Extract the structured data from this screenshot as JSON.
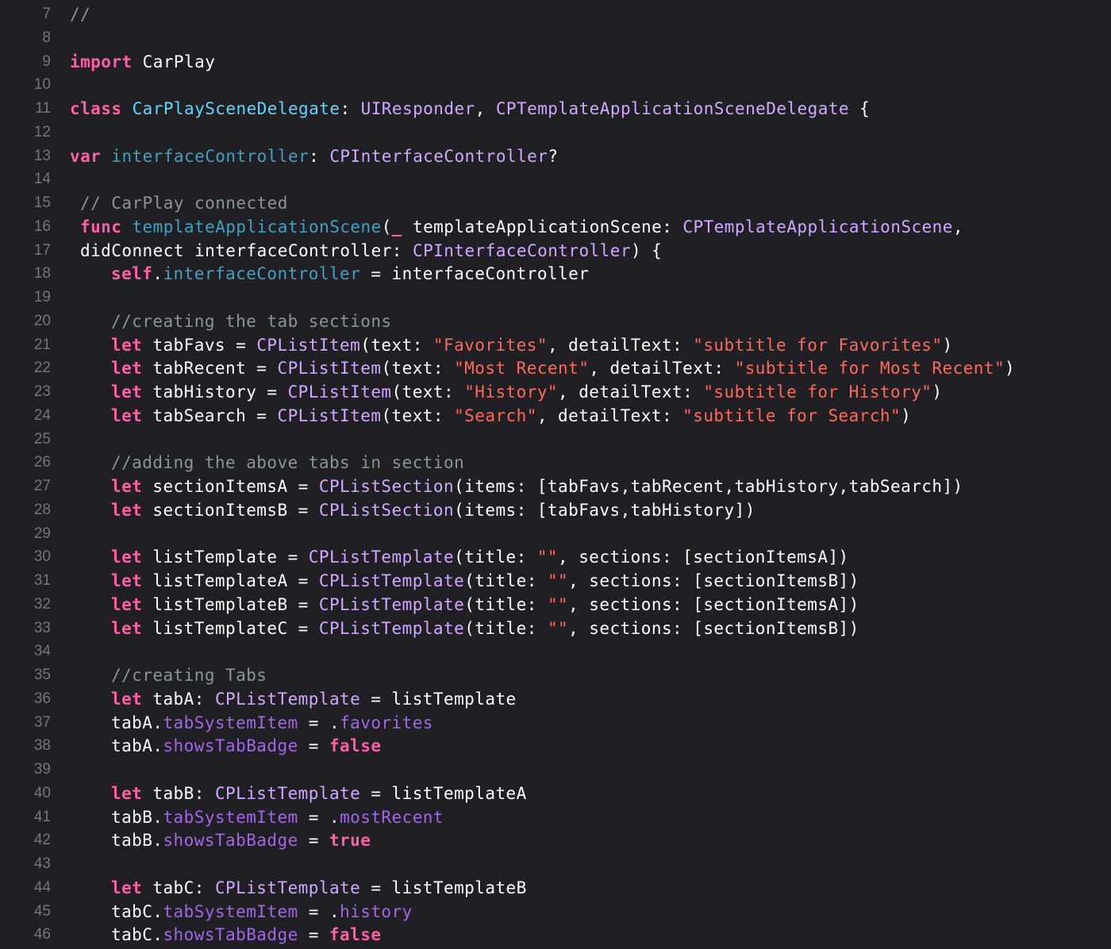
{
  "editor": {
    "colors": {
      "background": "#1f1f24",
      "line_number": "#75767a",
      "plain": "#ffffff",
      "keyword": "#fc5fa3",
      "type": "#d0a8ff",
      "declaration": "#5dd8ff",
      "declaration_other": "#41a1c0",
      "property": "#a167e6",
      "string": "#fc6a5d",
      "comment": "#8c9399"
    },
    "lines": [
      {
        "number": "7",
        "indent": 0,
        "tokens": [
          {
            "t": "//",
            "c": "comment"
          }
        ]
      },
      {
        "number": "8",
        "indent": 0,
        "tokens": []
      },
      {
        "number": "9",
        "indent": 0,
        "tokens": [
          {
            "t": "import",
            "c": "keyword"
          },
          {
            "t": " CarPlay",
            "c": "plain"
          }
        ]
      },
      {
        "number": "10",
        "indent": 0,
        "tokens": []
      },
      {
        "number": "11",
        "indent": 0,
        "tokens": [
          {
            "t": "class",
            "c": "keyword"
          },
          {
            "t": " ",
            "c": "plain"
          },
          {
            "t": "CarPlaySceneDelegate",
            "c": "declaration"
          },
          {
            "t": ": ",
            "c": "plain"
          },
          {
            "t": "UIResponder",
            "c": "type"
          },
          {
            "t": ", ",
            "c": "plain"
          },
          {
            "t": "CPTemplateApplicationSceneDelegate",
            "c": "type"
          },
          {
            "t": " {",
            "c": "plain"
          }
        ]
      },
      {
        "number": "12",
        "indent": 0,
        "tokens": []
      },
      {
        "number": "13",
        "indent": 0,
        "tokens": [
          {
            "t": "var",
            "c": "keyword"
          },
          {
            "t": " ",
            "c": "plain"
          },
          {
            "t": "interfaceController",
            "c": "declaration_other"
          },
          {
            "t": ": ",
            "c": "plain"
          },
          {
            "t": "CPInterfaceController",
            "c": "type"
          },
          {
            "t": "?",
            "c": "plain"
          }
        ]
      },
      {
        "number": "14",
        "indent": 0,
        "tokens": []
      },
      {
        "number": "15",
        "indent": 1,
        "tokens": [
          {
            "t": "// CarPlay connected",
            "c": "comment"
          }
        ]
      },
      {
        "number": "16",
        "indent": 1,
        "tokens": [
          {
            "t": "func",
            "c": "keyword"
          },
          {
            "t": " ",
            "c": "plain"
          },
          {
            "t": "templateApplicationScene",
            "c": "declaration_other"
          },
          {
            "t": "(",
            "c": "plain"
          },
          {
            "t": "_",
            "c": "keyword"
          },
          {
            "t": " templateApplicationScene: ",
            "c": "plain"
          },
          {
            "t": "CPTemplateApplicationScene",
            "c": "type"
          },
          {
            "t": ",",
            "c": "plain"
          }
        ]
      },
      {
        "number": "17",
        "indent": 1,
        "tokens": [
          {
            "t": "didConnect interfaceController: ",
            "c": "plain"
          },
          {
            "t": "CPInterfaceController",
            "c": "type"
          },
          {
            "t": ") {",
            "c": "plain"
          }
        ]
      },
      {
        "number": "18",
        "indent": 4,
        "tokens": [
          {
            "t": "self",
            "c": "keyword"
          },
          {
            "t": ".",
            "c": "plain"
          },
          {
            "t": "interfaceController",
            "c": "declaration_other"
          },
          {
            "t": " = interfaceController",
            "c": "plain"
          }
        ]
      },
      {
        "number": "19",
        "indent": 0,
        "tokens": []
      },
      {
        "number": "20",
        "indent": 4,
        "tokens": [
          {
            "t": "//creating the tab sections",
            "c": "comment"
          }
        ]
      },
      {
        "number": "21",
        "indent": 4,
        "tokens": [
          {
            "t": "let",
            "c": "keyword"
          },
          {
            "t": " tabFavs = ",
            "c": "plain"
          },
          {
            "t": "CPListItem",
            "c": "type"
          },
          {
            "t": "(text: ",
            "c": "plain"
          },
          {
            "t": "\"Favorites\"",
            "c": "string"
          },
          {
            "t": ", detailText: ",
            "c": "plain"
          },
          {
            "t": "\"subtitle for Favorites\"",
            "c": "string"
          },
          {
            "t": ")",
            "c": "plain"
          }
        ]
      },
      {
        "number": "22",
        "indent": 4,
        "tokens": [
          {
            "t": "let",
            "c": "keyword"
          },
          {
            "t": " tabRecent = ",
            "c": "plain"
          },
          {
            "t": "CPListItem",
            "c": "type"
          },
          {
            "t": "(text: ",
            "c": "plain"
          },
          {
            "t": "\"Most Recent\"",
            "c": "string"
          },
          {
            "t": ", detailText: ",
            "c": "plain"
          },
          {
            "t": "\"subtitle for Most Recent\"",
            "c": "string"
          },
          {
            "t": ")",
            "c": "plain"
          }
        ]
      },
      {
        "number": "23",
        "indent": 4,
        "tokens": [
          {
            "t": "let",
            "c": "keyword"
          },
          {
            "t": " tabHistory = ",
            "c": "plain"
          },
          {
            "t": "CPListItem",
            "c": "type"
          },
          {
            "t": "(text: ",
            "c": "plain"
          },
          {
            "t": "\"History\"",
            "c": "string"
          },
          {
            "t": ", detailText: ",
            "c": "plain"
          },
          {
            "t": "\"subtitle for History\"",
            "c": "string"
          },
          {
            "t": ")",
            "c": "plain"
          }
        ]
      },
      {
        "number": "24",
        "indent": 4,
        "tokens": [
          {
            "t": "let",
            "c": "keyword"
          },
          {
            "t": " tabSearch = ",
            "c": "plain"
          },
          {
            "t": "CPListItem",
            "c": "type"
          },
          {
            "t": "(text: ",
            "c": "plain"
          },
          {
            "t": "\"Search\"",
            "c": "string"
          },
          {
            "t": ", detailText: ",
            "c": "plain"
          },
          {
            "t": "\"subtitle for Search\"",
            "c": "string"
          },
          {
            "t": ")",
            "c": "plain"
          }
        ]
      },
      {
        "number": "25",
        "indent": 0,
        "tokens": []
      },
      {
        "number": "26",
        "indent": 4,
        "tokens": [
          {
            "t": "//adding the above tabs in section",
            "c": "comment"
          }
        ]
      },
      {
        "number": "27",
        "indent": 4,
        "tokens": [
          {
            "t": "let",
            "c": "keyword"
          },
          {
            "t": " sectionItemsA = ",
            "c": "plain"
          },
          {
            "t": "CPListSection",
            "c": "type"
          },
          {
            "t": "(items: [tabFavs,tabRecent,tabHistory,tabSearch])",
            "c": "plain"
          }
        ]
      },
      {
        "number": "28",
        "indent": 4,
        "tokens": [
          {
            "t": "let",
            "c": "keyword"
          },
          {
            "t": " sectionItemsB = ",
            "c": "plain"
          },
          {
            "t": "CPListSection",
            "c": "type"
          },
          {
            "t": "(items: [tabFavs,tabHistory])",
            "c": "plain"
          }
        ]
      },
      {
        "number": "29",
        "indent": 0,
        "tokens": []
      },
      {
        "number": "30",
        "indent": 4,
        "tokens": [
          {
            "t": "let",
            "c": "keyword"
          },
          {
            "t": " listTemplate = ",
            "c": "plain"
          },
          {
            "t": "CPListTemplate",
            "c": "type"
          },
          {
            "t": "(title: ",
            "c": "plain"
          },
          {
            "t": "\"\"",
            "c": "string"
          },
          {
            "t": ", sections: [sectionItemsA])",
            "c": "plain"
          }
        ]
      },
      {
        "number": "31",
        "indent": 4,
        "tokens": [
          {
            "t": "let",
            "c": "keyword"
          },
          {
            "t": " listTemplateA = ",
            "c": "plain"
          },
          {
            "t": "CPListTemplate",
            "c": "type"
          },
          {
            "t": "(title: ",
            "c": "plain"
          },
          {
            "t": "\"\"",
            "c": "string"
          },
          {
            "t": ", sections: [sectionItemsB])",
            "c": "plain"
          }
        ]
      },
      {
        "number": "32",
        "indent": 4,
        "tokens": [
          {
            "t": "let",
            "c": "keyword"
          },
          {
            "t": " listTemplateB = ",
            "c": "plain"
          },
          {
            "t": "CPListTemplate",
            "c": "type"
          },
          {
            "t": "(title: ",
            "c": "plain"
          },
          {
            "t": "\"\"",
            "c": "string"
          },
          {
            "t": ", sections: [sectionItemsA])",
            "c": "plain"
          }
        ]
      },
      {
        "number": "33",
        "indent": 4,
        "tokens": [
          {
            "t": "let",
            "c": "keyword"
          },
          {
            "t": " listTemplateC = ",
            "c": "plain"
          },
          {
            "t": "CPListTemplate",
            "c": "type"
          },
          {
            "t": "(title: ",
            "c": "plain"
          },
          {
            "t": "\"\"",
            "c": "string"
          },
          {
            "t": ", sections: [sectionItemsB])",
            "c": "plain"
          }
        ]
      },
      {
        "number": "34",
        "indent": 0,
        "tokens": []
      },
      {
        "number": "35",
        "indent": 4,
        "tokens": [
          {
            "t": "//creating Tabs",
            "c": "comment"
          }
        ]
      },
      {
        "number": "36",
        "indent": 4,
        "tokens": [
          {
            "t": "let",
            "c": "keyword"
          },
          {
            "t": " tabA: ",
            "c": "plain"
          },
          {
            "t": "CPListTemplate",
            "c": "type"
          },
          {
            "t": " = listTemplate",
            "c": "plain"
          }
        ]
      },
      {
        "number": "37",
        "indent": 4,
        "tokens": [
          {
            "t": "tabA.",
            "c": "plain"
          },
          {
            "t": "tabSystemItem",
            "c": "property"
          },
          {
            "t": " = .",
            "c": "plain"
          },
          {
            "t": "favorites",
            "c": "property"
          }
        ]
      },
      {
        "number": "38",
        "indent": 4,
        "tokens": [
          {
            "t": "tabA.",
            "c": "plain"
          },
          {
            "t": "showsTabBadge",
            "c": "property"
          },
          {
            "t": " = ",
            "c": "plain"
          },
          {
            "t": "false",
            "c": "keyword"
          }
        ]
      },
      {
        "number": "39",
        "indent": 0,
        "tokens": []
      },
      {
        "number": "40",
        "indent": 4,
        "tokens": [
          {
            "t": "let",
            "c": "keyword"
          },
          {
            "t": " tabB: ",
            "c": "plain"
          },
          {
            "t": "CPListTemplate",
            "c": "type"
          },
          {
            "t": " = listTemplateA",
            "c": "plain"
          }
        ]
      },
      {
        "number": "41",
        "indent": 4,
        "tokens": [
          {
            "t": "tabB.",
            "c": "plain"
          },
          {
            "t": "tabSystemItem",
            "c": "property"
          },
          {
            "t": " = .",
            "c": "plain"
          },
          {
            "t": "mostRecent",
            "c": "property"
          }
        ]
      },
      {
        "number": "42",
        "indent": 4,
        "tokens": [
          {
            "t": "tabB.",
            "c": "plain"
          },
          {
            "t": "showsTabBadge",
            "c": "property"
          },
          {
            "t": " = ",
            "c": "plain"
          },
          {
            "t": "true",
            "c": "keyword"
          }
        ]
      },
      {
        "number": "43",
        "indent": 0,
        "tokens": []
      },
      {
        "number": "44",
        "indent": 4,
        "tokens": [
          {
            "t": "let",
            "c": "keyword"
          },
          {
            "t": " tabC: ",
            "c": "plain"
          },
          {
            "t": "CPListTemplate",
            "c": "type"
          },
          {
            "t": " = listTemplateB",
            "c": "plain"
          }
        ]
      },
      {
        "number": "45",
        "indent": 4,
        "tokens": [
          {
            "t": "tabC.",
            "c": "plain"
          },
          {
            "t": "tabSystemItem",
            "c": "property"
          },
          {
            "t": " = .",
            "c": "plain"
          },
          {
            "t": "history",
            "c": "property"
          }
        ]
      },
      {
        "number": "46",
        "indent": 4,
        "tokens": [
          {
            "t": "tabC.",
            "c": "plain"
          },
          {
            "t": "showsTabBadge",
            "c": "property"
          },
          {
            "t": " = ",
            "c": "plain"
          },
          {
            "t": "false",
            "c": "keyword"
          }
        ]
      }
    ]
  }
}
